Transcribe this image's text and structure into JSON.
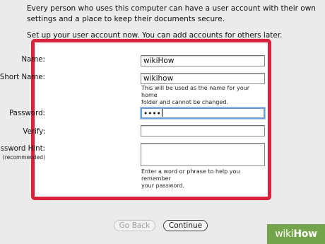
{
  "intro": {
    "lines": [
      "Every person who uses this computer can have a user account with their own",
      "settings and a place to keep their documents secure."
    ]
  },
  "setup_text": "Set up your user account now. You can add accounts for others later.",
  "form": {
    "name": {
      "label": "Name:",
      "value": "wikiHow"
    },
    "short_name": {
      "label": "Short Name:",
      "value": "wikihow",
      "help": [
        "This will be used as the name for your home",
        "folder and cannot be changed."
      ]
    },
    "password": {
      "label": "Password:",
      "value": "••••"
    },
    "verify": {
      "label": "Verify:",
      "value": ""
    },
    "hint": {
      "label": "Password Hint:",
      "sublabel": "(recommended)",
      "value": "",
      "help": [
        "Enter a word or phrase to help you remember",
        "your password."
      ]
    },
    "highlight_color": "#d8233c"
  },
  "buttons": {
    "back": "Go Back",
    "continue": "Continue"
  },
  "watermark": {
    "wiki": "wiki",
    "how": "How"
  }
}
